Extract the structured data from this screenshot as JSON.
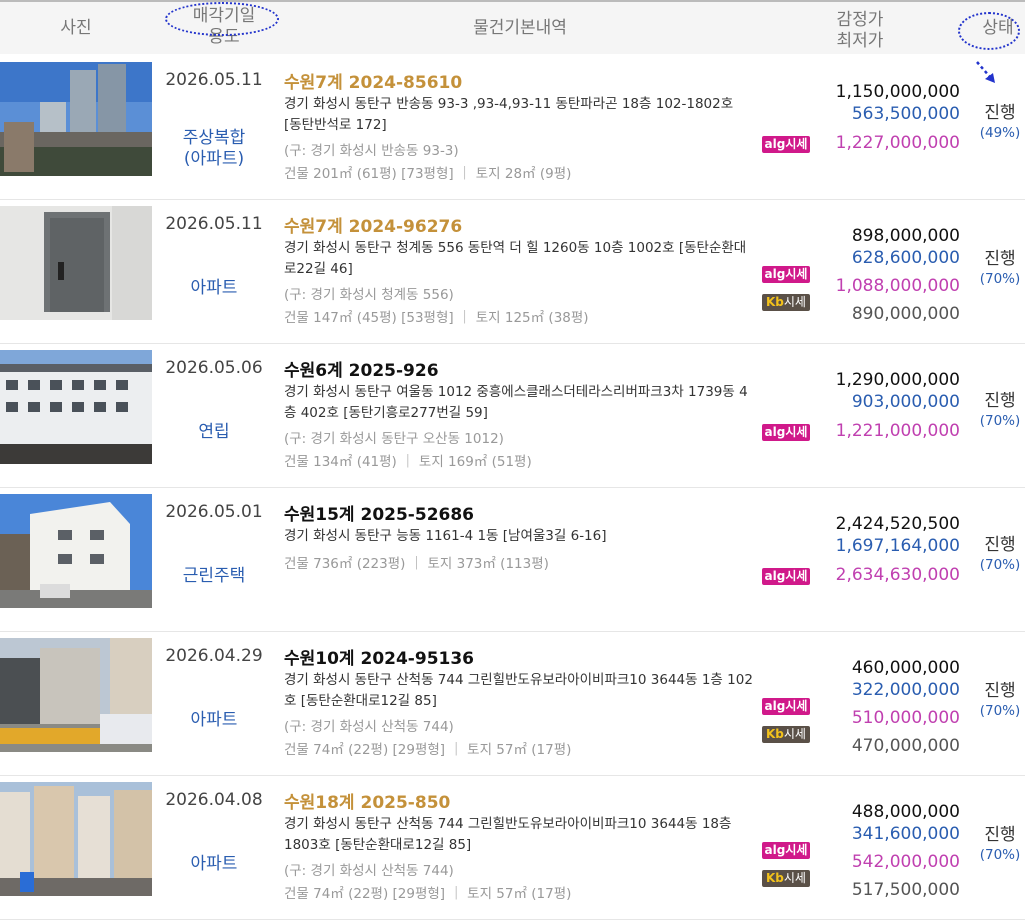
{
  "header": {
    "photo": "사진",
    "date_line1": "매각기일",
    "date_line2": "용도",
    "desc": "물건기본내역",
    "price_line1": "감정가",
    "price_line2": "최저가",
    "status": "상태"
  },
  "badges": {
    "alg": "alg시세",
    "kb_k": "Kb",
    "kb_label": "시세"
  },
  "listings": [
    {
      "date": "2026.05.11",
      "type": "주상복합\n(아파트)",
      "case_no": "수원7계 2024-85610",
      "address": "경기 화성시 동탄구 반송동 93-3 ,93-4,93-11 동탄파라곤 18층 102-1802호 [동탄반석로 172]",
      "old_address": "(구: 경기 화성시 반송동 93-3)",
      "area": "건물 201㎡ (61평) [73평형]  ｜  토지 28㎡ (9평)",
      "appraisal": "1,150,000,000",
      "minimum": "563,500,000",
      "alg_price": "1,227,000,000",
      "kb_price": "",
      "status": "진행",
      "rate": "(49%)"
    },
    {
      "date": "2026.05.11",
      "type": "아파트",
      "case_no": "수원7계 2024-96276",
      "address": "경기 화성시 동탄구 청계동 556 동탄역 더 힐 1260동 10층 1002호 [동탄순환대로22길 46]",
      "old_address": "(구: 경기 화성시 청계동 556)",
      "area": "건물 147㎡ (45평) [53평형]  ｜  토지 125㎡ (38평)",
      "appraisal": "898,000,000",
      "minimum": "628,600,000",
      "alg_price": "1,088,000,000",
      "kb_price": "890,000,000",
      "status": "진행",
      "rate": "(70%)"
    },
    {
      "date": "2026.05.06",
      "type": "연립",
      "case_no": "수원6계 2025-926",
      "address": "경기 화성시 동탄구 여울동 1012 중흥에스클래스더테라스리버파크3차 1739동 4층 402호 [동탄기흥로277번길 59]",
      "old_address": "(구: 경기 화성시 동탄구 오산동 1012)",
      "area": "건물 134㎡ (41평)  ｜  토지 169㎡ (51평)",
      "appraisal": "1,290,000,000",
      "minimum": "903,000,000",
      "alg_price": "1,221,000,000",
      "kb_price": "",
      "status": "진행",
      "rate": "(70%)"
    },
    {
      "date": "2026.05.01",
      "type": "근린주택",
      "case_no": "수원15계 2025-52686",
      "address": "경기 화성시 동탄구 능동 1161-4 1동 [남여울3길 6-16]",
      "old_address": "",
      "area": "건물 736㎡ (223평)  ｜  토지 373㎡ (113평)",
      "appraisal": "2,424,520,500",
      "minimum": "1,697,164,000",
      "alg_price": "2,634,630,000",
      "kb_price": "",
      "status": "진행",
      "rate": "(70%)"
    },
    {
      "date": "2026.04.29",
      "type": "아파트",
      "case_no": "수원10계 2024-95136",
      "address": "경기 화성시 동탄구 산척동 744 그린힐반도유보라아이비파크10 3644동 1층 102호 [동탄순환대로12길 85]",
      "old_address": "(구: 경기 화성시 산척동 744)",
      "area": "건물 74㎡ (22평) [29평형]  ｜  토지 57㎡ (17평)",
      "appraisal": "460,000,000",
      "minimum": "322,000,000",
      "alg_price": "510,000,000",
      "kb_price": "470,000,000",
      "status": "진행",
      "rate": "(70%)"
    },
    {
      "date": "2026.04.08",
      "type": "아파트",
      "case_no": "수원18계 2025-850",
      "address": "경기 화성시 동탄구 산척동 744 그린힐반도유보라아이비파크10 3644동 18층 1803호 [동탄순환대로12길 85]",
      "old_address": "(구: 경기 화성시 산척동 744)",
      "area": "건물 74㎡ (22평) [29평형]  ｜  토지 57㎡ (17평)",
      "appraisal": "488,000,000",
      "minimum": "341,600,000",
      "alg_price": "542,000,000",
      "kb_price": "517,500,000",
      "status": "진행",
      "rate": "(70%)"
    }
  ]
}
